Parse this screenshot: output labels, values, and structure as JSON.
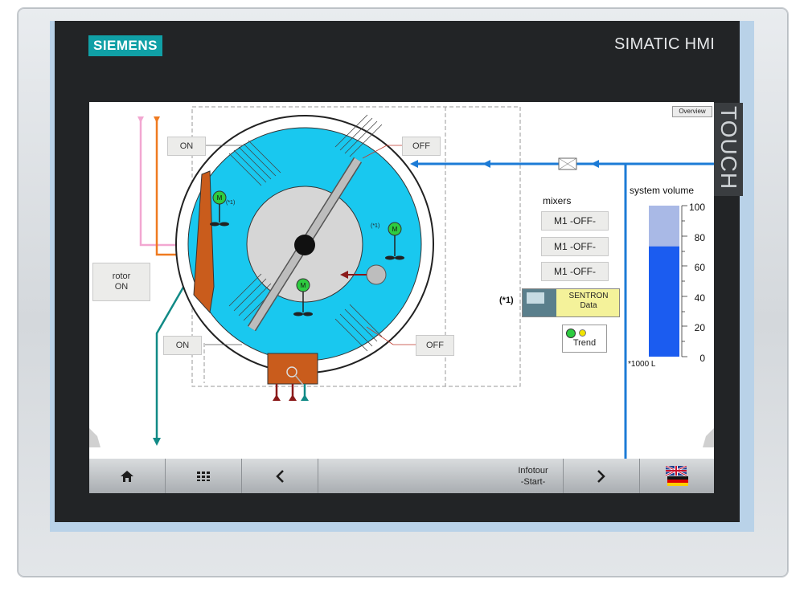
{
  "device": {
    "brand": "SIEMENS",
    "model": "SIMATIC HMI",
    "touch_label": "TOUCH"
  },
  "screen": {
    "overview_label": "Overview",
    "buttons": {
      "on_top": "ON",
      "off_top": "OFF",
      "on_bottom": "ON",
      "off_bottom": "OFF",
      "rotor": "rotor\nON"
    },
    "mixers": {
      "title": "mixers",
      "items": [
        "M1 -OFF-",
        "M1 -OFF-",
        "M1 -OFF-"
      ]
    },
    "footnote_marker": "(*1)",
    "sentron": {
      "label": "SENTRON\nData"
    },
    "trend": {
      "label": "Trend"
    },
    "motor_label": "M",
    "motor_note": "(*1)",
    "volume": {
      "title": "system volume",
      "unit": "*1000 L",
      "ticks": [
        "100",
        "80",
        "60",
        "40",
        "20",
        "0"
      ],
      "level_percent": 73,
      "capacity_fill_percent": 100
    }
  },
  "taskbar": {
    "infotour_label": "Infotour\n-Start-",
    "items": [
      "home-icon",
      "grid-icon",
      "chevron-left-icon",
      "infotour",
      "chevron-right-icon",
      "language-flag-icon"
    ]
  },
  "colors": {
    "brand_teal": "#10a0a6",
    "tank_cyan": "#19c8ef",
    "pipe_blue": "#1c7bd6",
    "level_blue": "#1b5cf0"
  }
}
